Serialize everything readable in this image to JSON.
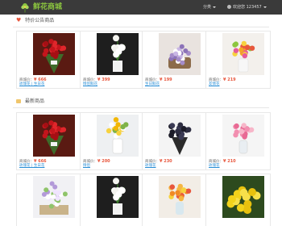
{
  "nav": {
    "brand": "鲜花商城",
    "menu_label": "分类",
    "user_label": "欢迎您 123457"
  },
  "sections": {
    "special": {
      "title": "特价公告商品",
      "icon": "heart-icon",
      "icon_color": "#e8573d"
    },
    "latest": {
      "title": "最新商品",
      "icon": "box-icon",
      "icon_color": "#f0c66c"
    }
  },
  "price_prefix": "商城价：",
  "special_products": [
    {
      "image": "red-roses-bouquet",
      "price": "666",
      "category": "玫瑰花 | 生日花"
    },
    {
      "image": "white-lilies-vase",
      "price": "399",
      "category": "情侣鲜花"
    },
    {
      "image": "purple-flower-basket",
      "price": "199",
      "category": "生日鲜花"
    },
    {
      "image": "mixed-flowers-vase",
      "price": "219",
      "category": "友情花"
    }
  ],
  "latest_products": [
    {
      "image": "red-roses-bouquet",
      "price": "666",
      "category": "玫瑰花 | 生日花"
    },
    {
      "image": "yellow-flowers-vase",
      "price": "200",
      "category": "情侣"
    },
    {
      "image": "black-roses-bouquet",
      "price": "230",
      "category": "玫瑰花"
    },
    {
      "image": "pink-roses-vase",
      "price": "210",
      "category": "玫瑰花"
    },
    {
      "image": "white-purple-flowers-pot",
      "price": "",
      "category": ""
    },
    {
      "image": "white-lilies-vase",
      "price": "",
      "category": ""
    },
    {
      "image": "orange-flowers-vase",
      "price": "",
      "category": ""
    },
    {
      "image": "yellow-chrysanthemums",
      "price": "",
      "category": ""
    }
  ],
  "colors": {
    "nav_bg": "#3a3a3a",
    "brand": "#8cc63f",
    "price": "#e8573d",
    "link": "#2b8fd6"
  }
}
